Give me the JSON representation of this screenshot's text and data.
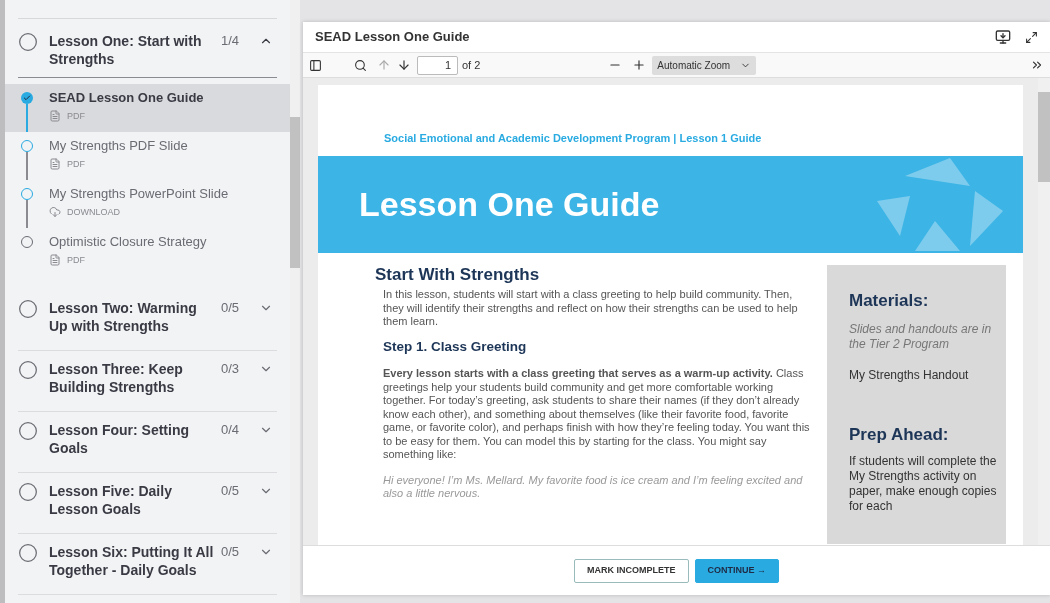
{
  "sidebar": {
    "lessons": [
      {
        "title": "Lesson One: Start with Strengths",
        "progress": "1/4",
        "expanded": true,
        "items": [
          {
            "title": "SEAD Lesson One Guide",
            "kind": "pdf",
            "type_label": "PDF",
            "completed": true,
            "locked": false,
            "selected": true
          },
          {
            "title": "My Strengths PDF Slide",
            "kind": "pdf",
            "type_label": "PDF",
            "completed": false,
            "locked": false,
            "selected": false
          },
          {
            "title": "My Strengths PowerPoint Slide",
            "kind": "download",
            "type_label": "DOWNLOAD",
            "completed": false,
            "locked": false,
            "selected": false
          },
          {
            "title": "Optimistic Closure Strategy",
            "kind": "pdf",
            "type_label": "PDF",
            "completed": false,
            "locked": true,
            "selected": false
          }
        ]
      },
      {
        "title": "Lesson Two: Warming Up with Strengths",
        "progress": "0/5",
        "expanded": false
      },
      {
        "title": "Lesson Three: Keep Building Strengths",
        "progress": "0/3",
        "expanded": false
      },
      {
        "title": "Lesson Four: Setting Goals",
        "progress": "0/4",
        "expanded": false
      },
      {
        "title": "Lesson Five: Daily Lesson Goals",
        "progress": "0/5",
        "expanded": false
      },
      {
        "title": "Lesson Six: Putting It All Together - Daily Goals",
        "progress": "0/5",
        "expanded": false
      }
    ]
  },
  "viewer": {
    "title": "SEAD Lesson One Guide",
    "toolbar": {
      "page_number": "1",
      "page_count": "of 2",
      "zoom": "Automatic Zoom"
    },
    "document": {
      "header": "Social Emotional and Academic Development Program | Lesson 1 Guide",
      "banner_title": "Lesson One Guide",
      "section_title": "Start With Strengths",
      "intro": "In this lesson, students will start with a class greeting to help build community. Then, they will identify their strengths and reflect on how their strengths can be used to help them learn.",
      "step_title": "Step 1. Class Greeting",
      "step_text": "**Every lesson starts with a class greeting that serves as a warm-up activity.** Class greetings help your students build community and get more comfortable working together. For today’s greeting, ask students to share their names (if they don’t already know each other), and something about themselves (like their favorite food, favorite game, or favorite color), and perhaps finish with how they’re feeling today. You want this to be easy for them. You can model this by starting for the class. You might say something like:",
      "quote": "Hi everyone! I’m Ms. Mellard. My favorite food is ice cream and I’m feeling excited and also a little nervous.",
      "materials_title": "Materials:",
      "materials_note": "Slides and handouts are in the Tier 2 Program",
      "materials_item": "My Strengths Handout",
      "prep_title": "Prep Ahead:",
      "prep_text": "If students will complete the My Strengths activity on paper, make enough copies for each"
    }
  },
  "footer": {
    "buttons": [
      {
        "label": "MARK INCOMPLETE",
        "kind": "secondary"
      },
      {
        "label": "CONTINUE →",
        "kind": "primary"
      }
    ]
  }
}
